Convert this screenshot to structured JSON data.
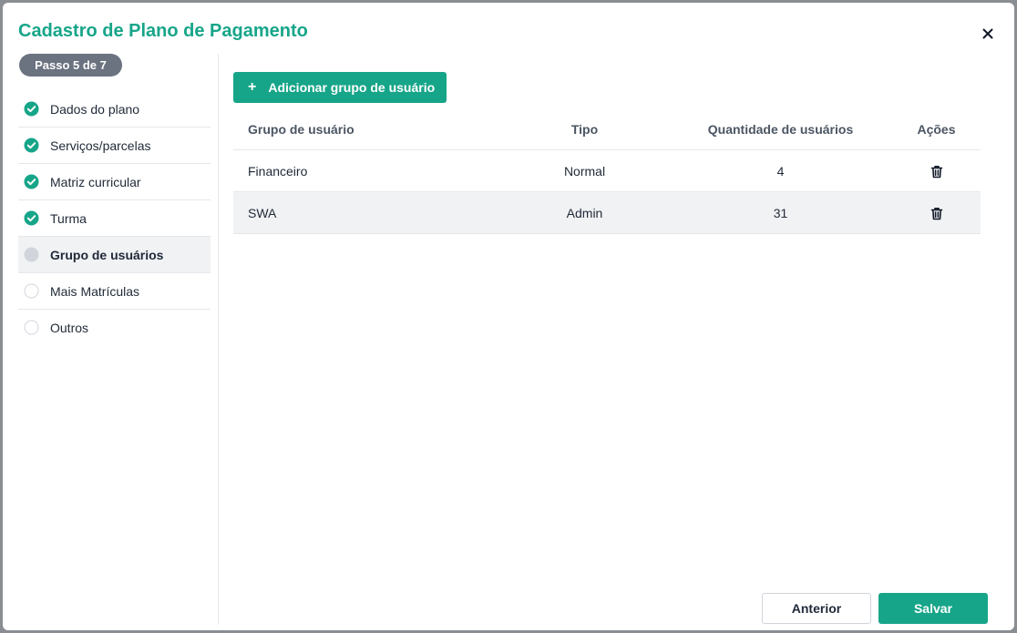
{
  "modal": {
    "title": "Cadastro de Plano de Pagamento"
  },
  "sidebar": {
    "step_badge": "Passo 5 de 7",
    "steps": [
      {
        "label": "Dados do plano",
        "status": "complete"
      },
      {
        "label": "Serviços/parcelas",
        "status": "complete"
      },
      {
        "label": "Matriz curricular",
        "status": "complete"
      },
      {
        "label": "Turma",
        "status": "complete"
      },
      {
        "label": "Grupo de usuários",
        "status": "current"
      },
      {
        "label": "Mais Matrículas",
        "status": "pending"
      },
      {
        "label": "Outros",
        "status": "pending"
      }
    ]
  },
  "main": {
    "add_button_label": "Adicionar grupo de usuário",
    "add_button_icon": "plus-icon",
    "table": {
      "headers": [
        "Grupo de usuário",
        "Tipo",
        "Quantidade de usuários",
        "Ações"
      ],
      "rows": [
        {
          "grupo": "Financeiro",
          "tipo": "Normal",
          "quantidade": "4",
          "action_icon": "trash-icon"
        },
        {
          "grupo": "SWA",
          "tipo": "Admin",
          "quantidade": "31",
          "action_icon": "trash-icon"
        }
      ]
    }
  },
  "footer": {
    "previous_label": "Anterior",
    "save_label": "Salvar"
  },
  "colors": {
    "accent": "#17a589",
    "badge": "#6b7280",
    "step_current": "#d1d5db",
    "active_row": "#f1f2f4"
  }
}
